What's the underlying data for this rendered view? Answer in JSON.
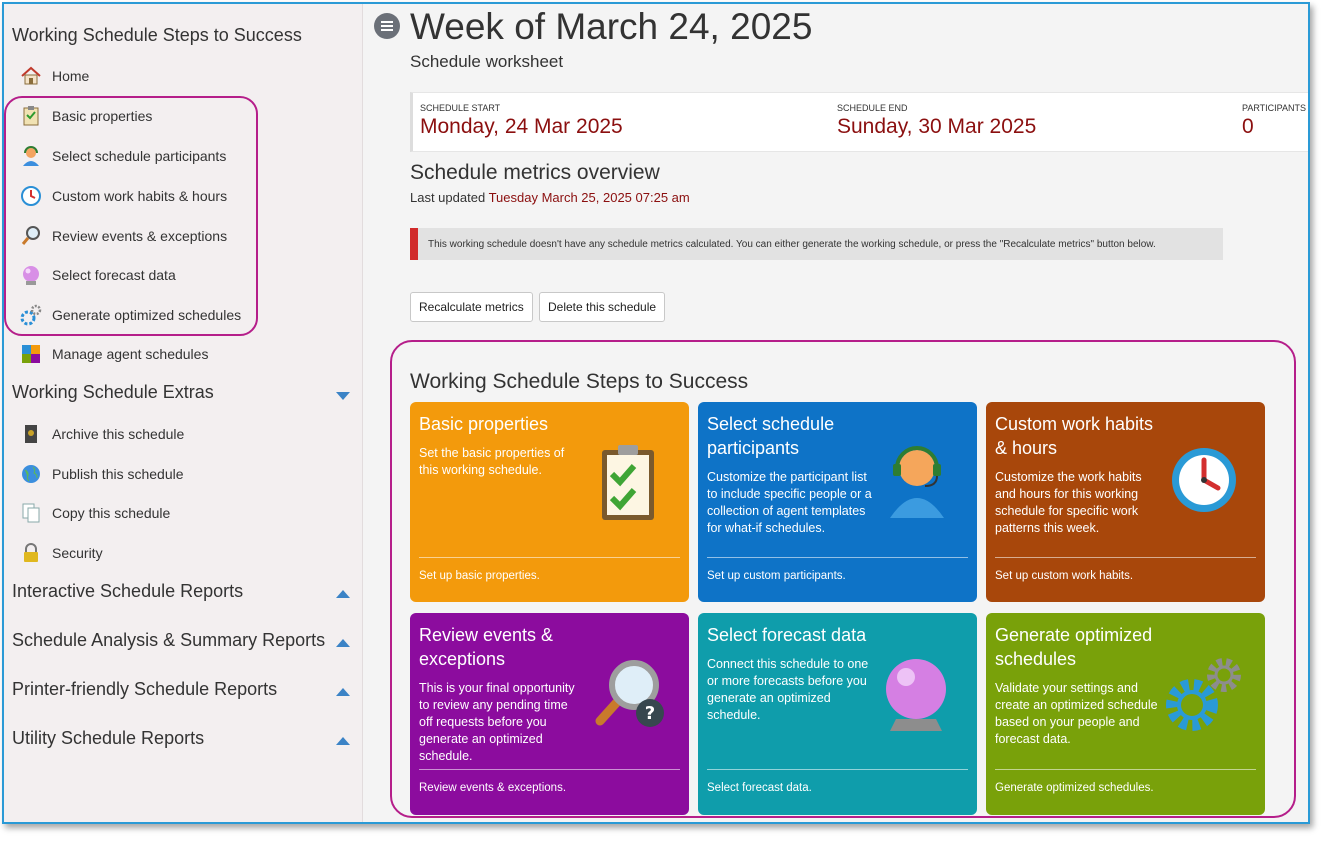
{
  "sidebar": {
    "title": "Working Schedule Steps to Success",
    "steps": [
      {
        "label": "Home",
        "icon": "home-icon"
      },
      {
        "label": "Basic properties",
        "icon": "clipboard-check-icon"
      },
      {
        "label": "Select schedule participants",
        "icon": "agent-icon"
      },
      {
        "label": "Custom work habits & hours",
        "icon": "clock-icon"
      },
      {
        "label": "Review events & exceptions",
        "icon": "magnifier-question-icon"
      },
      {
        "label": "Select forecast data",
        "icon": "crystal-ball-icon"
      },
      {
        "label": "Generate optimized schedules",
        "icon": "gears-icon"
      },
      {
        "label": "Manage agent schedules",
        "icon": "puzzle-icon"
      }
    ],
    "extras_title": "Working Schedule Extras",
    "extras": [
      {
        "label": "Archive this schedule",
        "icon": "archive-icon"
      },
      {
        "label": "Publish this schedule",
        "icon": "globe-icon"
      },
      {
        "label": "Copy this schedule",
        "icon": "copy-icon"
      },
      {
        "label": "Security",
        "icon": "lock-icon"
      }
    ],
    "sections": [
      "Interactive Schedule Reports",
      "Schedule Analysis & Summary Reports",
      "Printer-friendly Schedule Reports",
      "Utility Schedule Reports"
    ]
  },
  "header": {
    "title": "Week of March 24, 2025",
    "subtitle": "Schedule worksheet"
  },
  "summary": {
    "start_label": "SCHEDULE START",
    "start_value": "Monday, 24 Mar 2025",
    "end_label": "SCHEDULE END",
    "end_value": "Sunday, 30 Mar 2025",
    "participants_label": "PARTICIPANTS",
    "participants_value": "0"
  },
  "metrics": {
    "title": "Schedule metrics overview",
    "updated_prefix": "Last updated",
    "updated_value": "Tuesday March 25, 2025 07:25 am",
    "alert": "This working schedule doesn't have any schedule metrics calculated. You can either generate the working schedule, or press the \"Recalculate metrics\" button below.",
    "recalc_label": "Recalculate metrics",
    "delete_label": "Delete this schedule"
  },
  "steps": {
    "title": "Working Schedule Steps to Success",
    "cards": [
      {
        "title": "Basic properties",
        "desc": "Set the basic properties of this working schedule.",
        "link": "Set up basic properties.",
        "color": "#f39a0c",
        "icon": "clipboard-check-icon"
      },
      {
        "title": "Select schedule participants",
        "desc": "Customize the participant list to include specific people or a collection of agent templates for what-if schedules.",
        "link": "Set up custom participants.",
        "color": "#0e73c7",
        "icon": "agent-icon"
      },
      {
        "title": "Custom work habits & hours",
        "desc": "Customize the work habits and hours for this working schedule for specific work patterns this week.",
        "link": "Set up custom work habits.",
        "color": "#a8470b",
        "icon": "clock-icon"
      },
      {
        "title": "Review events & exceptions",
        "desc": "This is your final opportunity to review any pending time off requests before you generate an optimized schedule.",
        "link": "Review events & exceptions.",
        "color": "#8c0c9e",
        "icon": "magnifier-question-icon"
      },
      {
        "title": "Select forecast data",
        "desc": "Connect this schedule to one or more forecasts before you generate an optimized schedule.",
        "link": "Select forecast data.",
        "color": "#0f9dab",
        "icon": "crystal-ball-icon"
      },
      {
        "title": "Generate optimized schedules",
        "desc": "Validate your settings and create an optimized schedule based on your people and forecast data.",
        "link": "Generate optimized schedules.",
        "color": "#79a10a",
        "icon": "gears-icon"
      }
    ]
  }
}
